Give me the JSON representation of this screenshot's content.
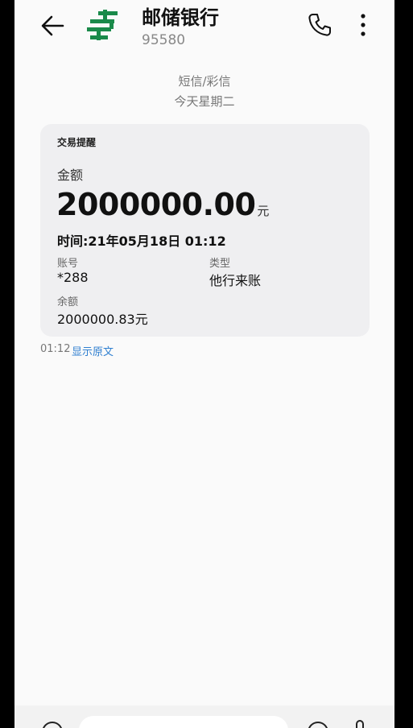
{
  "header": {
    "contact_name": "邮储银行",
    "contact_number": "95580"
  },
  "separator": {
    "message_type": "短信/彩信",
    "date": "今天星期二"
  },
  "card": {
    "title": "交易提醒",
    "amount_label": "金额",
    "amount_value": "2000000.00",
    "amount_unit": "元",
    "time_text": "时间:21年05月18日 01:12",
    "account_label": "账号",
    "account_value": "*288",
    "type_label": "类型",
    "type_value": "他行来账",
    "balance_label": "余额",
    "balance_value": "2000000.83元"
  },
  "message_meta": {
    "time": "01:12",
    "show_original_label": "显示原文"
  },
  "colors": {
    "brand_green": "#1a8a4a",
    "link_blue": "#2f7fd0"
  },
  "icons": {
    "back": "arrow-left-icon",
    "logo": "postal-bank-logo",
    "call": "phone-icon",
    "more": "more-vertical-icon"
  }
}
